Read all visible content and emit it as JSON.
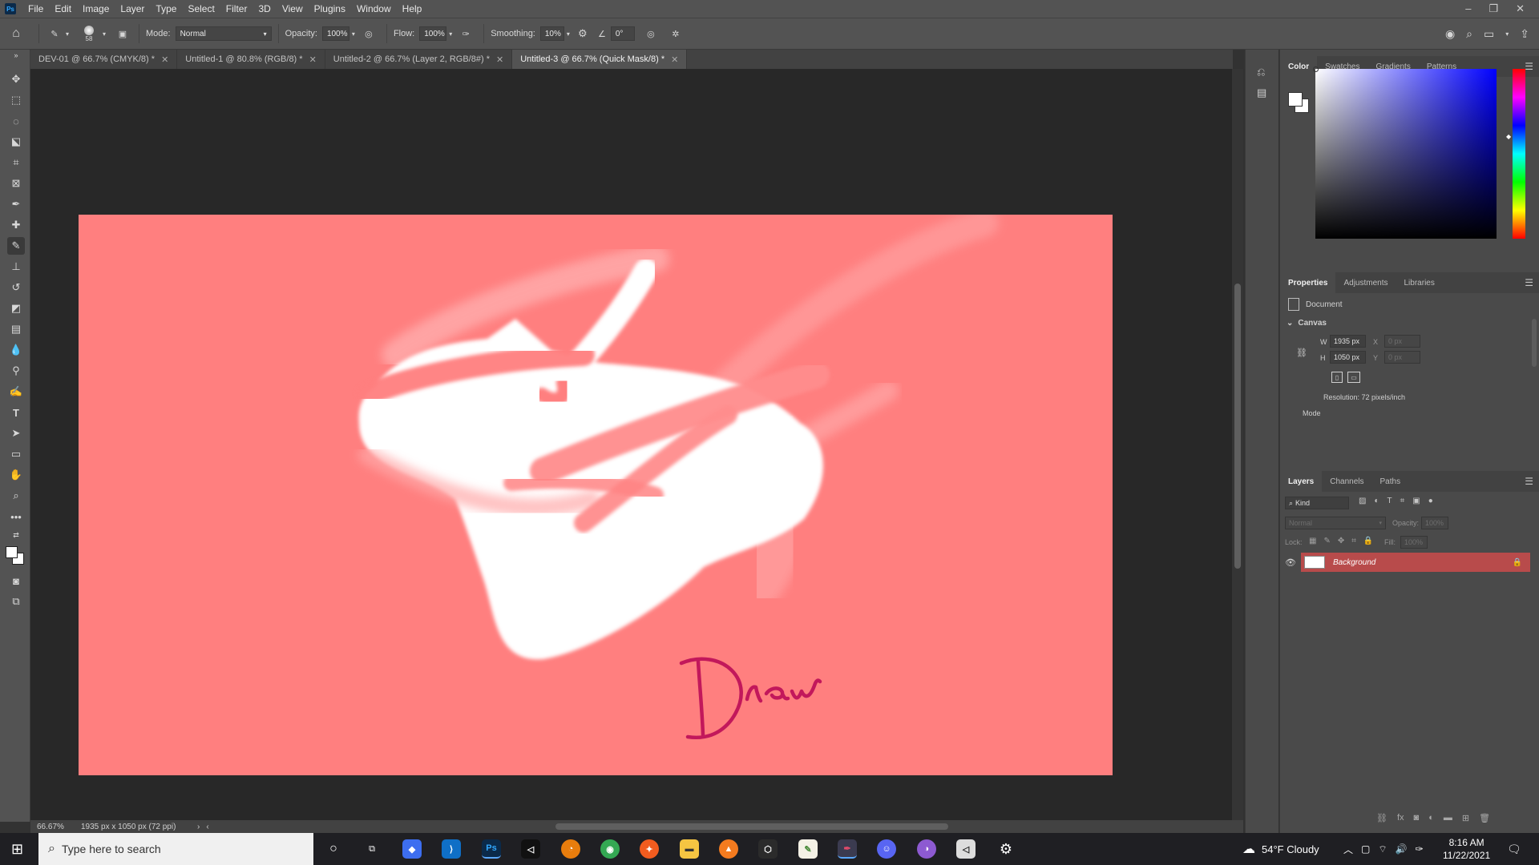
{
  "menubar": {
    "app_abbrev": "Ps",
    "items": [
      "File",
      "Edit",
      "Image",
      "Layer",
      "Type",
      "Select",
      "Filter",
      "3D",
      "View",
      "Plugins",
      "Window",
      "Help"
    ],
    "window_controls": [
      "–",
      "❐",
      "✕"
    ]
  },
  "options": {
    "brush_size": "58",
    "mode_label": "Mode:",
    "mode_value": "Normal",
    "opacity_label": "Opacity:",
    "opacity_value": "100%",
    "flow_label": "Flow:",
    "flow_value": "100%",
    "smoothing_label": "Smoothing:",
    "smoothing_value": "10%",
    "angle_value": "0°"
  },
  "tabs": [
    {
      "label": "DEV-01 @ 66.7% (CMYK/8) *",
      "active": false
    },
    {
      "label": "Untitled-1 @ 80.8% (RGB/8) *",
      "active": false
    },
    {
      "label": "Untitled-2 @ 66.7% (Layer 2, RGB/8#) *",
      "active": false
    },
    {
      "label": "Untitled-3 @ 66.7% (Quick Mask/8) *",
      "active": true
    }
  ],
  "canvas": {
    "background_color": "#ff7f7f",
    "handwritten_text": "Draw",
    "ink_color": "#c2185b"
  },
  "status": {
    "zoom": "66.67%",
    "doc_info": "1935 px x 1050 px (72 ppi)"
  },
  "color_panel": {
    "tabs": [
      "Color",
      "Swatches",
      "Gradients",
      "Patterns"
    ]
  },
  "properties_panel": {
    "tabs": [
      "Properties",
      "Adjustments",
      "Libraries"
    ],
    "doc_label": "Document",
    "section": "Canvas",
    "w_label": "W",
    "w_value": "1935 px",
    "h_label": "H",
    "h_value": "1050 px",
    "x_label": "X",
    "x_placeholder": "0 px",
    "y_label": "Y",
    "y_placeholder": "0 px",
    "resolution": "Resolution: 72 pixels/inch",
    "mode_label": "Mode"
  },
  "layers_panel": {
    "tabs": [
      "Layers",
      "Channels",
      "Paths"
    ],
    "kind_placeholder": "Kind",
    "blend_mode": "Normal",
    "opacity_label": "Opacity:",
    "opacity_value": "100%",
    "lock_label": "Lock:",
    "fill_label": "Fill:",
    "fill_value": "100%",
    "layers": [
      {
        "name": "Background",
        "visible": true,
        "locked": true
      }
    ],
    "selected_color": "#b84b4b"
  },
  "taskbar": {
    "search_placeholder": "Type here to search",
    "weather": "54°F  Cloudy",
    "time": "8:16 AM",
    "date": "11/22/2021"
  }
}
